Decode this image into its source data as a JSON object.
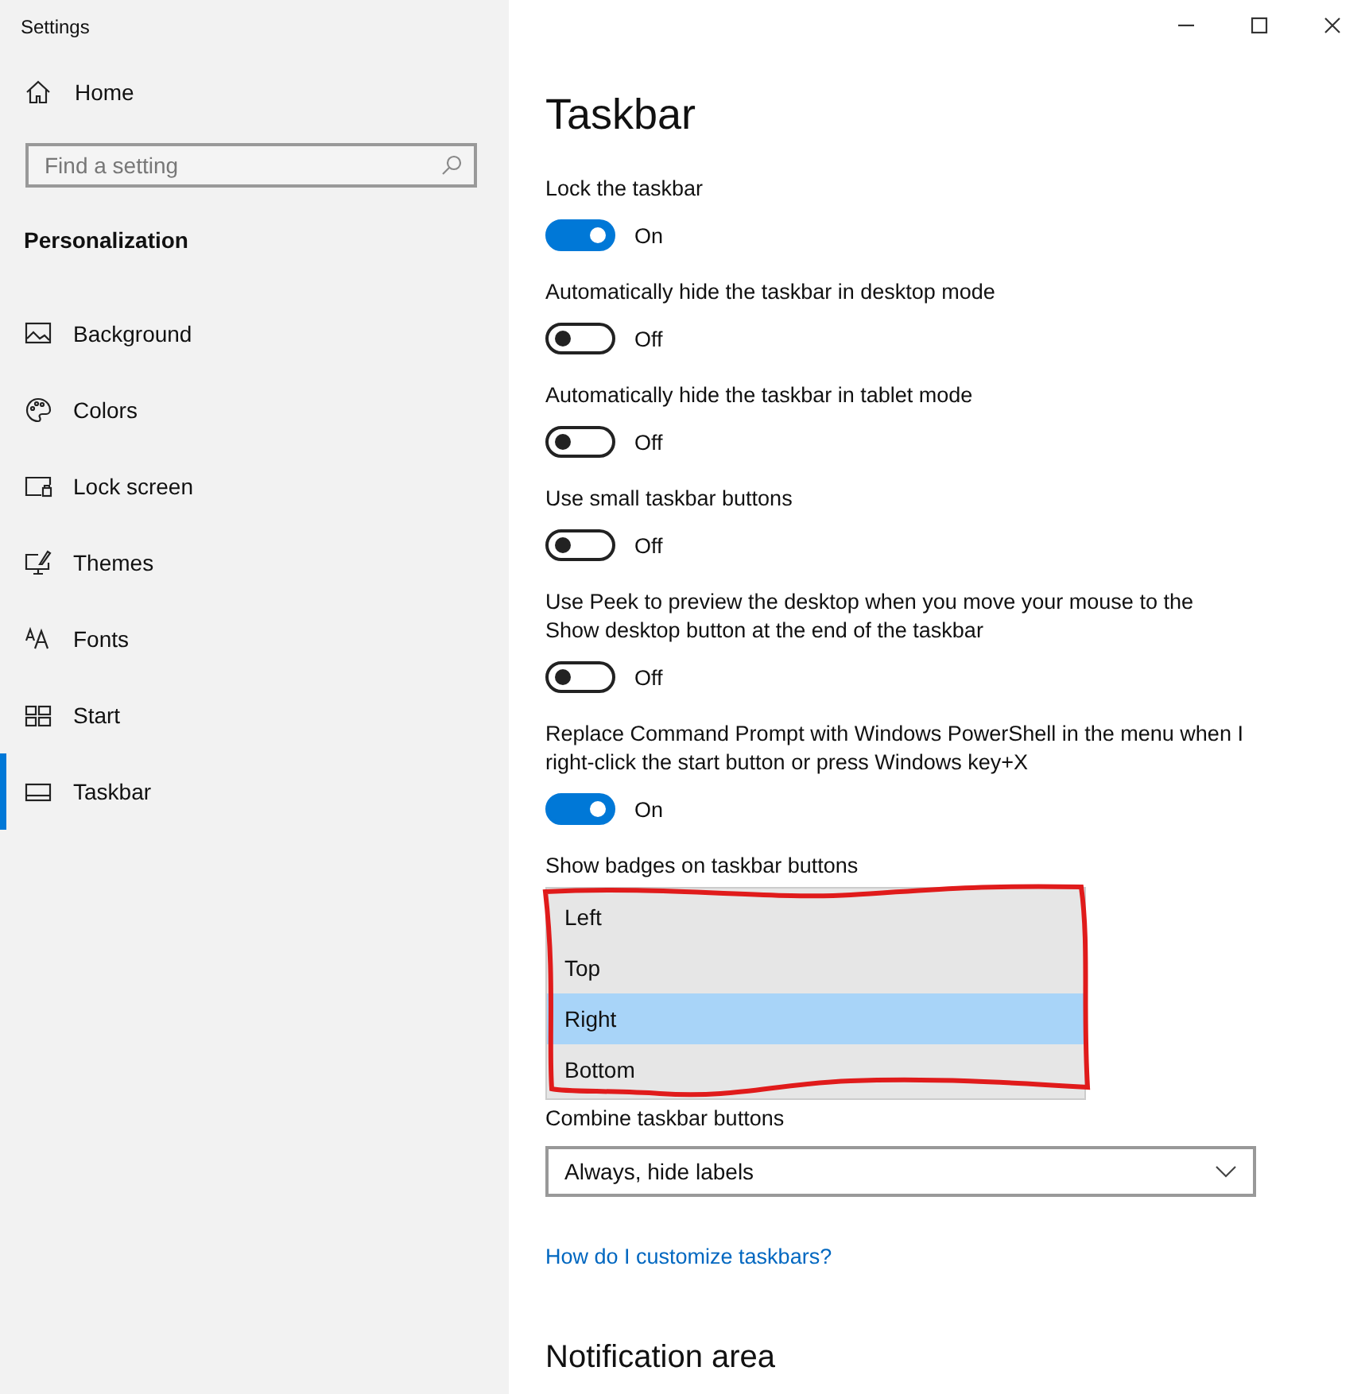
{
  "window": {
    "title": "Settings",
    "controls": [
      {
        "kind": "minimize"
      },
      {
        "kind": "maximize"
      },
      {
        "kind": "close"
      }
    ]
  },
  "sidebar": {
    "home": "Home",
    "search": {
      "placeholder": "Find a setting"
    },
    "section": "Personalization",
    "items": [
      {
        "label": "Background",
        "selected": false
      },
      {
        "label": "Colors",
        "selected": false
      },
      {
        "label": "Lock screen",
        "selected": false
      },
      {
        "label": "Themes",
        "selected": false
      },
      {
        "label": "Fonts",
        "selected": false
      },
      {
        "label": "Start",
        "selected": false
      },
      {
        "label": "Taskbar",
        "selected": true
      }
    ]
  },
  "page": {
    "title": "Taskbar",
    "toggles": [
      {
        "label": "Lock the taskbar",
        "on": true,
        "state_text": "On"
      },
      {
        "label": "Automatically hide the taskbar in desktop mode",
        "on": false,
        "state_text": "Off"
      },
      {
        "label": "Automatically hide the taskbar in tablet mode",
        "on": false,
        "state_text": "Off"
      },
      {
        "label": "Use small taskbar buttons",
        "on": false,
        "state_text": "Off"
      },
      {
        "label": "Use Peek to preview the desktop when you move your mouse to the Show desktop button at the end of the taskbar",
        "on": false,
        "state_text": "Off"
      },
      {
        "label": "Replace Command Prompt with Windows PowerShell in the menu when I right-click the start button or press Windows key+X",
        "on": true,
        "state_text": "On"
      }
    ],
    "badges": {
      "label": "Show badges on taskbar buttons",
      "options": [
        {
          "label": "Left",
          "selected": false
        },
        {
          "label": "Top",
          "selected": false
        },
        {
          "label": "Right",
          "selected": true
        },
        {
          "label": "Bottom",
          "selected": false
        }
      ],
      "annotation": {
        "kind": "outline"
      }
    },
    "combine": {
      "label": "Combine taskbar buttons",
      "value": "Always, hide labels"
    },
    "link": "How do I customize taskbars?",
    "section_heading": "Notification area"
  }
}
